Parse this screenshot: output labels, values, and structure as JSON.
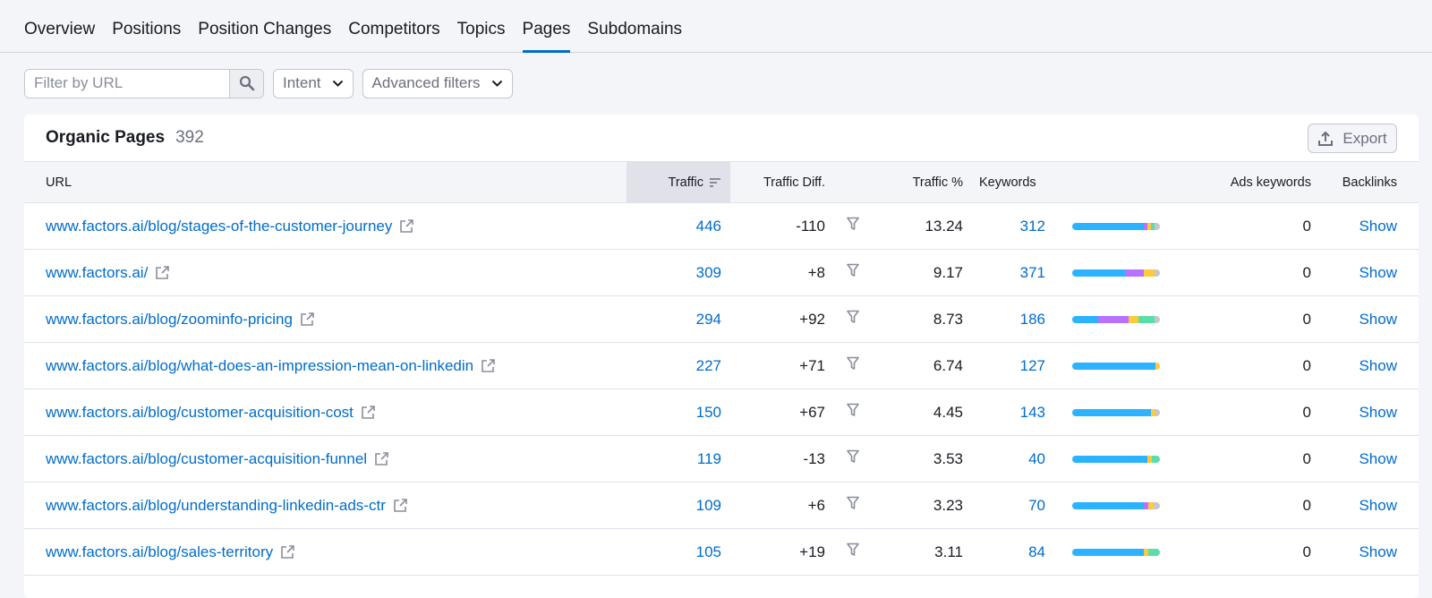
{
  "tabs": [
    {
      "label": "Overview"
    },
    {
      "label": "Positions"
    },
    {
      "label": "Position Changes"
    },
    {
      "label": "Competitors"
    },
    {
      "label": "Topics"
    },
    {
      "label": "Pages",
      "active": true
    },
    {
      "label": "Subdomains"
    }
  ],
  "filters": {
    "url_placeholder": "Filter by URL",
    "intent_label": "Intent",
    "advanced_label": "Advanced filters"
  },
  "card": {
    "title": "Organic Pages",
    "count": "392",
    "export_label": "Export"
  },
  "columns": {
    "url": "URL",
    "traffic": "Traffic",
    "traffic_diff": "Traffic Diff.",
    "traffic_pct": "Traffic %",
    "keywords": "Keywords",
    "ads_keywords": "Ads keywords",
    "backlinks": "Backlinks"
  },
  "intent_colors": {
    "informational": "#2bb3ff",
    "navigational": "#b772ff",
    "commercial": "#ffca3a",
    "transactional": "#59ddaa",
    "other": "#c4c7cf"
  },
  "rows": [
    {
      "url": "www.factors.ai/blog/stages-of-the-customer-journey",
      "traffic": "446",
      "diff": "-110",
      "pct": "13.24",
      "keywords": "312",
      "ads": "0",
      "backlinks": "Show",
      "intent": [
        0.82,
        0.04,
        0.04,
        0.04,
        0.06
      ]
    },
    {
      "url": "www.factors.ai/",
      "traffic": "309",
      "diff": "+8",
      "pct": "9.17",
      "keywords": "371",
      "ads": "0",
      "backlinks": "Show",
      "intent": [
        0.6,
        0.22,
        0.12,
        0.0,
        0.06
      ]
    },
    {
      "url": "www.factors.ai/blog/zoominfo-pricing",
      "traffic": "294",
      "diff": "+92",
      "pct": "8.73",
      "keywords": "186",
      "ads": "0",
      "backlinks": "Show",
      "intent": [
        0.3,
        0.34,
        0.12,
        0.18,
        0.06
      ]
    },
    {
      "url": "www.factors.ai/blog/what-does-an-impression-mean-on-linkedin",
      "traffic": "227",
      "diff": "+71",
      "pct": "6.74",
      "keywords": "127",
      "ads": "0",
      "backlinks": "Show",
      "intent": [
        0.95,
        0.0,
        0.05,
        0.0,
        0.0
      ]
    },
    {
      "url": "www.factors.ai/blog/customer-acquisition-cost",
      "traffic": "150",
      "diff": "+67",
      "pct": "4.45",
      "keywords": "143",
      "ads": "0",
      "backlinks": "Show",
      "intent": [
        0.9,
        0.0,
        0.05,
        0.0,
        0.05
      ]
    },
    {
      "url": "www.factors.ai/blog/customer-acquisition-funnel",
      "traffic": "119",
      "diff": "-13",
      "pct": "3.53",
      "keywords": "40",
      "ads": "0",
      "backlinks": "Show",
      "intent": [
        0.86,
        0.0,
        0.05,
        0.09,
        0.0
      ]
    },
    {
      "url": "www.factors.ai/blog/understanding-linkedin-ads-ctr",
      "traffic": "109",
      "diff": "+6",
      "pct": "3.23",
      "keywords": "70",
      "ads": "0",
      "backlinks": "Show",
      "intent": [
        0.82,
        0.05,
        0.06,
        0.0,
        0.07
      ]
    },
    {
      "url": "www.factors.ai/blog/sales-territory",
      "traffic": "105",
      "diff": "+19",
      "pct": "3.11",
      "keywords": "84",
      "ads": "0",
      "backlinks": "Show",
      "intent": [
        0.82,
        0.0,
        0.05,
        0.13,
        0.0
      ]
    }
  ]
}
